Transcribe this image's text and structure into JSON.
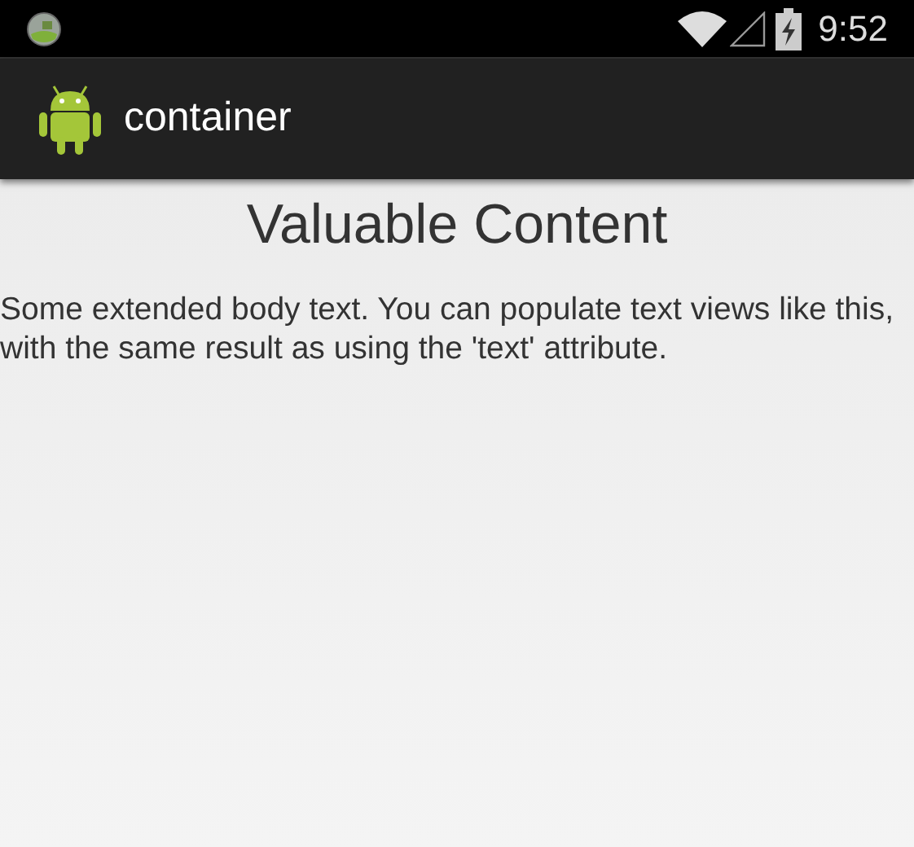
{
  "status_bar": {
    "time": "9:52"
  },
  "action_bar": {
    "title": "container"
  },
  "content": {
    "heading": "Valuable Content",
    "body": "Some extended body text. You can populate text views like this, with the same result as using the 'text' attribute."
  }
}
